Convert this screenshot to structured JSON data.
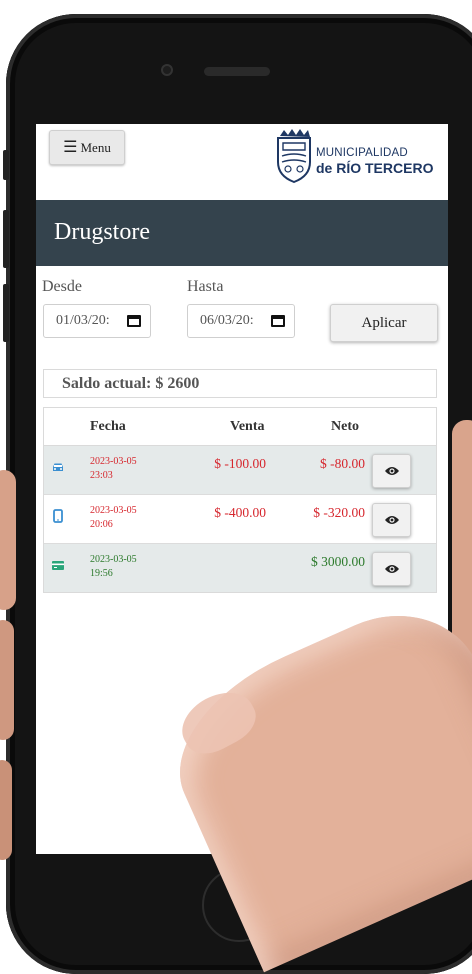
{
  "header": {
    "menu_icon": "☰",
    "menu_label": "Menu",
    "logo_icon": "coat-of-arms-icon",
    "logo_line1": "MUNICIPALIDAD",
    "logo_line2": "de RÍO TERCERO"
  },
  "page": {
    "title": "Drugstore"
  },
  "filters": {
    "from_label": "Desde",
    "from_value": "01/03/20:",
    "to_label": "Hasta",
    "to_value": "06/03/20:",
    "apply_label": "Aplicar"
  },
  "balance": {
    "text": "Saldo actual: $ 2600"
  },
  "table": {
    "headers": {
      "fecha": "Fecha",
      "venta": "Venta",
      "neto": "Neto"
    },
    "rows": [
      {
        "icon": "car-icon",
        "date": "2023-03-05",
        "time": "23:03",
        "venta": "$ -100.00",
        "neto": "$ -80.00",
        "color": "red"
      },
      {
        "icon": "phone-icon",
        "date": "2023-03-05",
        "time": "20:06",
        "venta": "$ -400.00",
        "neto": "$ -320.00",
        "color": "red"
      },
      {
        "icon": "card-icon",
        "date": "2023-03-05",
        "time": "19:56",
        "venta": "",
        "neto": "$ 3000.00",
        "color": "green"
      }
    ]
  },
  "colors": {
    "header_bar": "#34434d",
    "negative": "#d6262d",
    "positive": "#2c7a2c",
    "icon_blue": "#3a8fd1",
    "icon_green": "#2aa57a"
  }
}
